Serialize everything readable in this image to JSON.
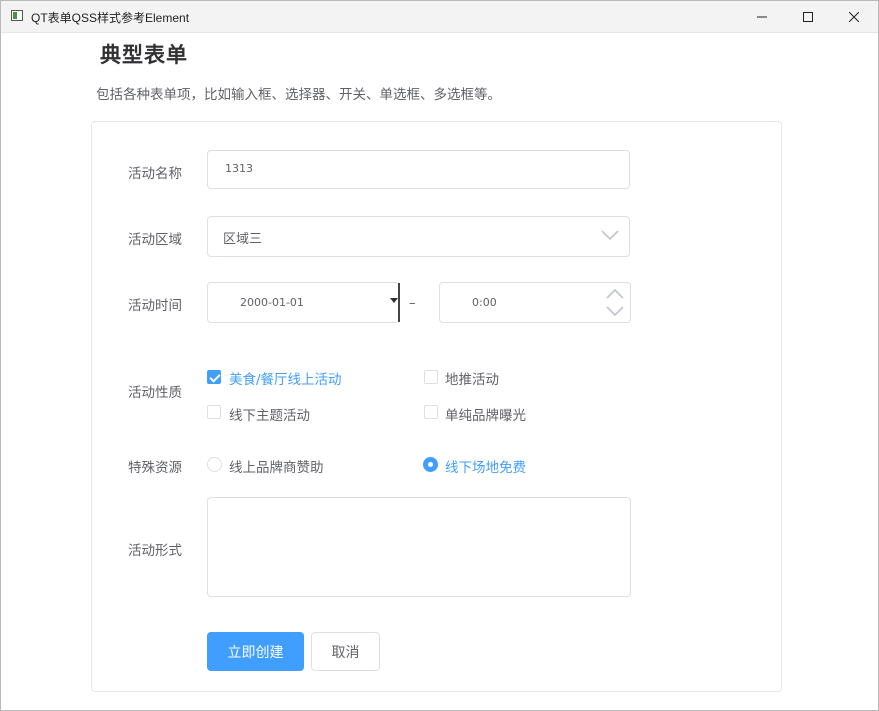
{
  "window": {
    "title": "QT表单QSS样式参考Element",
    "minimize": "—",
    "maximize": "☐",
    "close": "✕"
  },
  "header": {
    "title": "典型表单",
    "subtitle": "包括各种表单项，比如输入框、选择器、开关、单选框、多选框等。"
  },
  "form": {
    "name": {
      "label": "活动名称",
      "value": "1313"
    },
    "region": {
      "label": "活动区域",
      "value": "区域三"
    },
    "time": {
      "label": "活动时间",
      "date": "2000-01-01",
      "separator": "–",
      "time": "0:00"
    },
    "nature": {
      "label": "活动性质",
      "options": [
        {
          "label": "美食/餐厅线上活动",
          "checked": true
        },
        {
          "label": "地推活动",
          "checked": false
        },
        {
          "label": "线下主题活动",
          "checked": false
        },
        {
          "label": "单纯品牌曝光",
          "checked": false
        }
      ]
    },
    "resource": {
      "label": "特殊资源",
      "options": [
        {
          "label": "线上品牌商赞助",
          "selected": false
        },
        {
          "label": "线下场地免费",
          "selected": true
        }
      ]
    },
    "form_type": {
      "label": "活动形式",
      "value": ""
    }
  },
  "actions": {
    "submit": "立即创建",
    "cancel": "取消"
  },
  "colors": {
    "primary": "#409eff",
    "text": "#606266",
    "border": "#dcdfe6"
  }
}
